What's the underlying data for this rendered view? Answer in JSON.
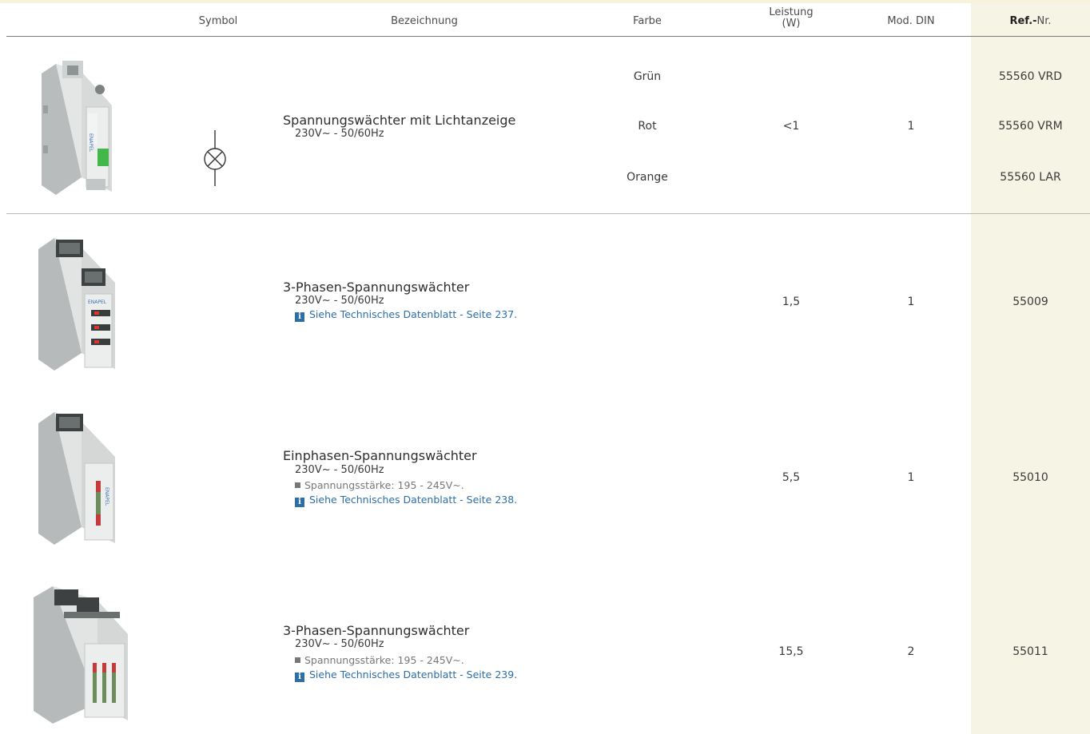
{
  "header": {
    "symbol": "Symbol",
    "bezeichnung": "Bezeichnung",
    "farbe": "Farbe",
    "leistung": "Leistung",
    "leistung_unit": "(W)",
    "mod_din": "Mod. DIN",
    "ref_bold": "Ref.-",
    "ref_rest": "Nr."
  },
  "row1": {
    "title": "Spannungswächter mit Lichtanzeige",
    "spec": "230V~ - 50/60Hz",
    "colors": [
      "Grün",
      "Rot",
      "Orange"
    ],
    "leistung": "<1",
    "din": "1",
    "refs": [
      "55560 VRD",
      "55560 VRM",
      "55560 LAR"
    ],
    "symbol_icon": "indicator-lamp-symbol-icon"
  },
  "row2": {
    "title": "3-Phasen-Spannungswächter",
    "spec": "230V~ - 50/60Hz",
    "info": "Siehe Technisches Datenblatt - Seite 237.",
    "leistung": "1,5",
    "din": "1",
    "ref": "55009"
  },
  "row3": {
    "title": "Einphasen-Spannungswächter",
    "spec": "230V~ - 50/60Hz",
    "bullet": "Spannungsstärke: 195 - 245V~.",
    "info": "Siehe Technisches Datenblatt - Seite 238.",
    "leistung": "5,5",
    "din": "1",
    "ref": "55010"
  },
  "row4": {
    "title": "3-Phasen-Spannungswächter",
    "spec": "230V~ - 50/60Hz",
    "bullet": "Spannungsstärke: 195 - 245V~.",
    "info": "Siehe Technisches Datenblatt - Seite 239.",
    "leistung": "15,5",
    "din": "2",
    "ref": "55011"
  },
  "info_icon": "i",
  "colors": {
    "ref_column_bg": "#f6f4e4",
    "link_blue": "#2c6ea6"
  }
}
